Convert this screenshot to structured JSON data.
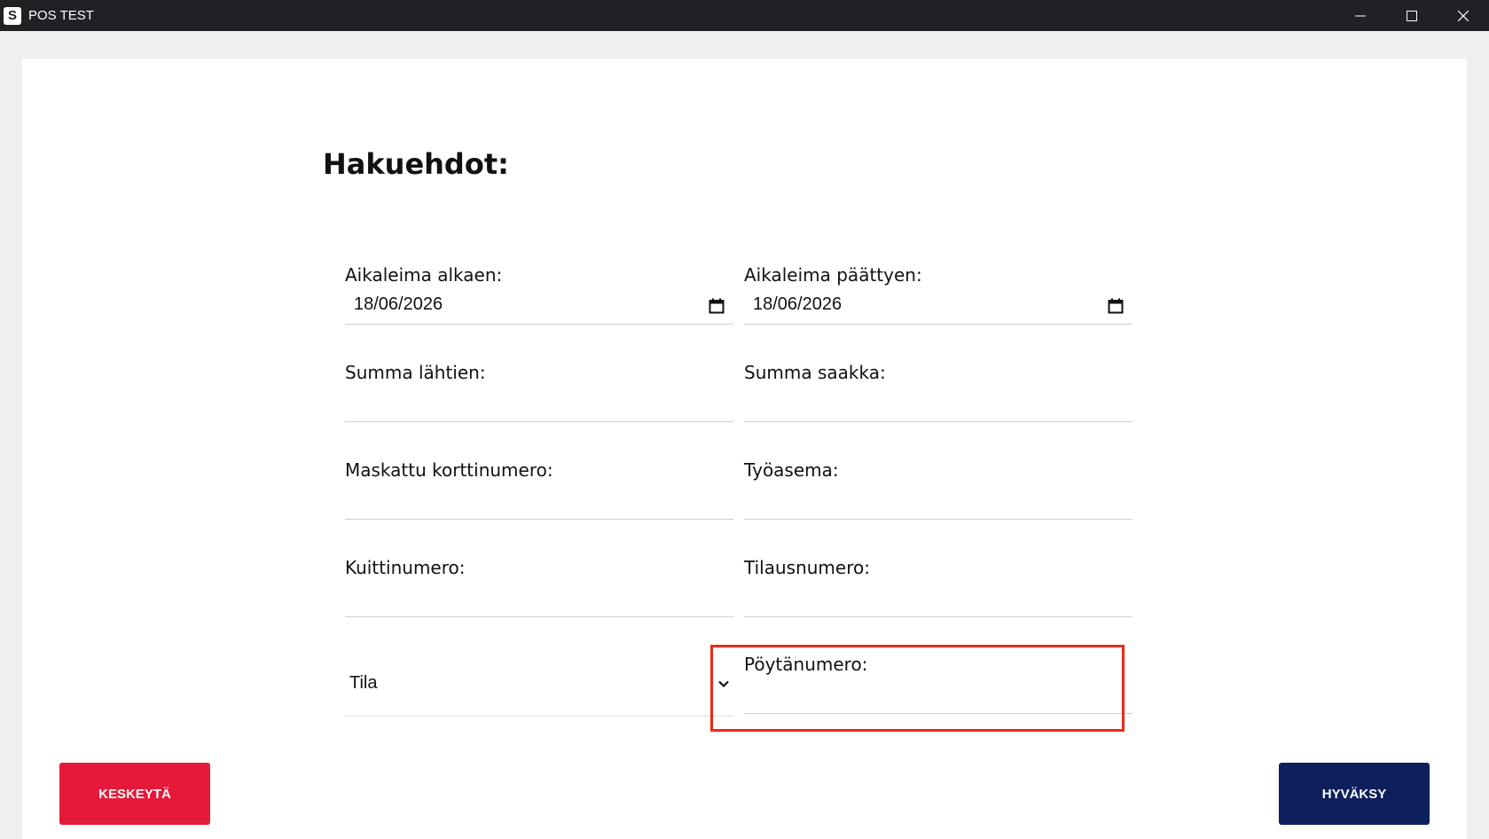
{
  "window": {
    "title": "POS TEST",
    "icon": "app-logo-icon",
    "icon_letter": "S",
    "controls": [
      "minimize-icon",
      "maximize-icon",
      "close-icon"
    ]
  },
  "form": {
    "title": "Hakuehdot:",
    "fields": {
      "aikaleima_alkaen": {
        "label": "Aikaleima alkaen:",
        "value": "18/06/2026",
        "icon": "calendar-icon"
      },
      "aikaleima_paattyen": {
        "label": "Aikaleima päättyen:",
        "value": "18/06/2026",
        "icon": "calendar-icon"
      },
      "summa_lahtien": {
        "label": "Summa lähtien:",
        "value": ""
      },
      "summa_saakka": {
        "label": "Summa saakka:",
        "value": ""
      },
      "maskattu_korttinumero": {
        "label": "Maskattu korttinumero:",
        "value": ""
      },
      "tyoasema": {
        "label": "Työasema:",
        "value": ""
      },
      "kuittinumero": {
        "label": "Kuittinumero:",
        "value": ""
      },
      "tilausnumero": {
        "label": "Tilausnumero:",
        "value": ""
      },
      "tila": {
        "selected": "Tila",
        "icon": "chevron-down-icon"
      },
      "poytanumero": {
        "label": "Pöytänumero:",
        "value": ""
      }
    }
  },
  "buttons": {
    "cancel": "KESKEYTÄ",
    "accept": "HYVÄKSY"
  },
  "colors": {
    "titlebar": "#202124",
    "cancel_button": "#e51939",
    "accept_button": "#0d1f5c",
    "highlight": "#ef2a17"
  }
}
